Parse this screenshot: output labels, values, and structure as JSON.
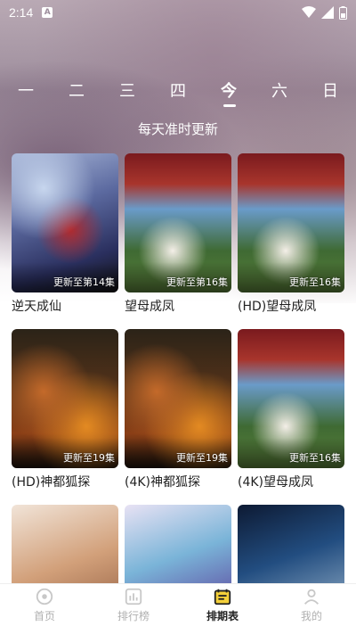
{
  "status": {
    "time": "2:14",
    "app_badge": "A"
  },
  "week": {
    "days": [
      "一",
      "二",
      "三",
      "四",
      "今",
      "六",
      "日"
    ],
    "active_index": 4
  },
  "subtitle": "每天准时更新",
  "shows": [
    {
      "title": "逆天成仙",
      "badge": "更新至第14集",
      "poster": "nitian"
    },
    {
      "title": "望母成凤",
      "badge": "更新至第16集",
      "poster": "wangmu"
    },
    {
      "title": "(HD)望母成凤",
      "badge": "更新至16集",
      "poster": "wangmu"
    },
    {
      "title": "(HD)神都狐探",
      "badge": "更新至19集",
      "poster": "hulu"
    },
    {
      "title": "(4K)神都狐探",
      "badge": "更新至19集",
      "poster": "hulu"
    },
    {
      "title": "(4K)望母成凤",
      "badge": "更新至16集",
      "poster": "wangmu"
    },
    {
      "title": "",
      "badge": "",
      "poster": "anime1"
    },
    {
      "title": "",
      "badge": "",
      "poster": "anime2"
    },
    {
      "title": "",
      "badge": "",
      "poster": "robot"
    }
  ],
  "tabbar": {
    "items": [
      {
        "label": "首页",
        "icon": "home-icon"
      },
      {
        "label": "排行榜",
        "icon": "chart-icon"
      },
      {
        "label": "排期表",
        "icon": "calendar-icon"
      },
      {
        "label": "我的",
        "icon": "profile-icon"
      }
    ],
    "active_index": 2
  }
}
